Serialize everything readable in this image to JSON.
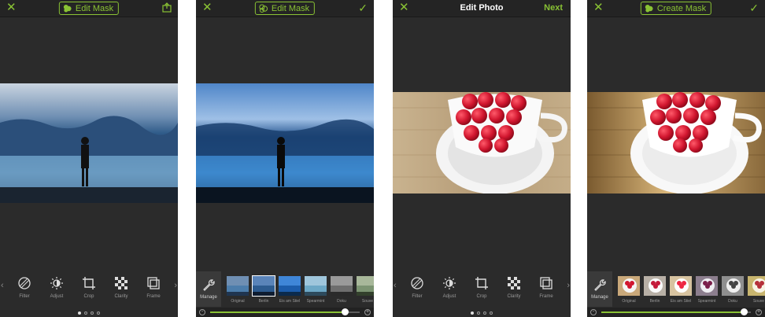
{
  "colors": {
    "accent": "#89c234",
    "bg": "#2b2b2b",
    "bar": "#242424"
  },
  "screens": [
    {
      "title": "Edit Mask",
      "left_icon": "close-icon",
      "right_icon": "share-icon",
      "tools": [
        {
          "icon": "filter-icon",
          "label": "Filter"
        },
        {
          "icon": "adjust-icon",
          "label": "Adjust"
        },
        {
          "icon": "crop-icon",
          "label": "Crop"
        },
        {
          "icon": "clarity-icon",
          "label": "Clarity"
        },
        {
          "icon": "frame-icon",
          "label": "Frame"
        }
      ],
      "page_indicator": {
        "count": 4,
        "active": 1
      }
    },
    {
      "title": "Edit Mask",
      "left_icon": "close-icon",
      "right_icon": "checkmark-icon",
      "manage_label": "Manage",
      "filters": [
        "Original",
        "Berlin",
        "Eis am Stiel",
        "Spearmint",
        "Doku",
        "Souve"
      ],
      "selected_filter": "Berlin",
      "intensity": 0.9
    },
    {
      "title": "Edit Photo",
      "left_icon": "close-icon",
      "next_label": "Next",
      "tools": [
        {
          "icon": "filter-icon",
          "label": "Filter"
        },
        {
          "icon": "adjust-icon",
          "label": "Adjust"
        },
        {
          "icon": "crop-icon",
          "label": "Crop"
        },
        {
          "icon": "clarity-icon",
          "label": "Clarity"
        },
        {
          "icon": "frame-icon",
          "label": "Frame"
        }
      ],
      "page_indicator": {
        "count": 4,
        "active": 1
      }
    },
    {
      "title": "Create Mask",
      "left_icon": "close-icon",
      "right_icon": "checkmark-icon",
      "manage_label": "Manage",
      "filters": [
        "Original",
        "Berlin",
        "Eis am Stiel",
        "Spearmint",
        "Doku",
        "Souve"
      ],
      "intensity": 0.95
    }
  ]
}
